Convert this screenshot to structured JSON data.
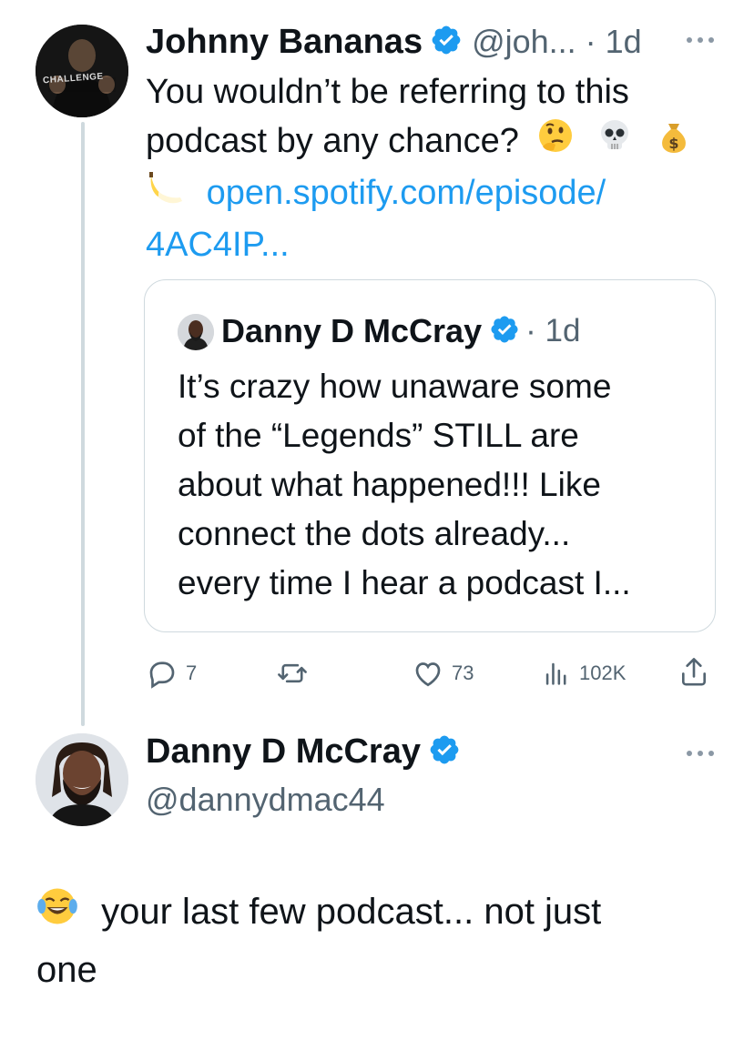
{
  "parent_tweet": {
    "author_name": "Johnny Bananas",
    "handle_time": "@joh... · 1d",
    "avatar_shirt_text": "CHALLENGE",
    "text_line1": "You wouldn’t be referring to this",
    "text_line2": "podcast by any chance?",
    "link_line1": "open.spotify.com/episode/",
    "link_line2": "4AC4IP...",
    "quoted": {
      "author_name": "Danny D McCray",
      "time": "· 1d",
      "lines": [
        "It’s crazy how unaware some",
        "of the “Legends” STILL are",
        "about what happened!!! Like",
        "connect the dots already...",
        "every time I hear a podcast I..."
      ]
    },
    "actions": {
      "replies": "7",
      "reposts": "",
      "likes": "73",
      "views": "102K"
    }
  },
  "reply_tweet": {
    "author_name": "Danny D McCray",
    "handle": "@dannydmac44",
    "text_line1": "your last few podcast... not just",
    "text_line2": "one"
  },
  "icons": [
    "verified-icon",
    "more-icon",
    "reply-icon",
    "repost-icon",
    "like-icon",
    "views-icon",
    "share-icon",
    "thinking-face-emoji",
    "skull-emoji",
    "money-bag-emoji",
    "banana-emoji",
    "laughing-tears-emoji"
  ],
  "colors": {
    "link": "#1d9bf0",
    "verified": "#1d9bf0",
    "secondary_text": "#536471"
  }
}
